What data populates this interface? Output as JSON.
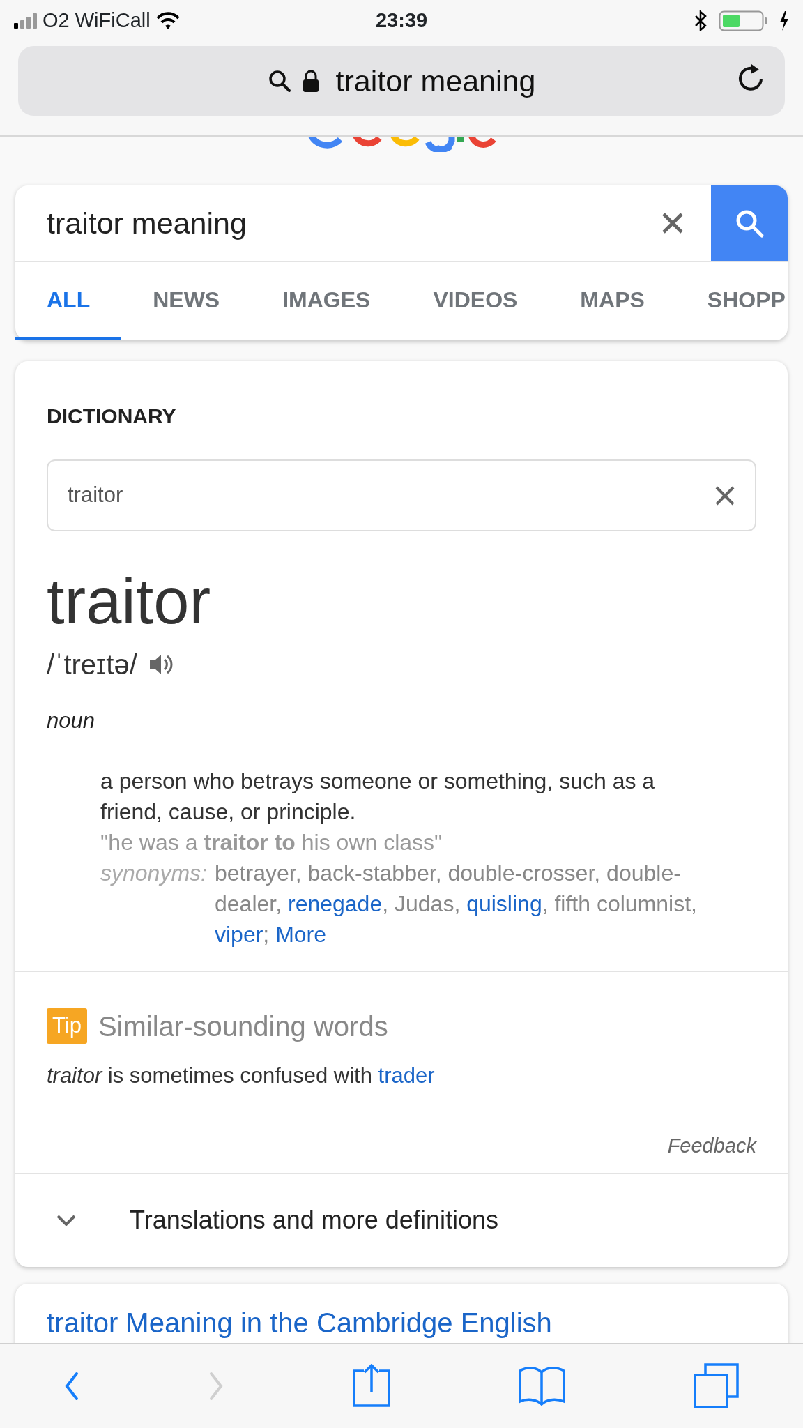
{
  "status_bar": {
    "carrier": "O2 WiFiCall",
    "time": "23:39"
  },
  "address_bar": {
    "text": "traitor meaning"
  },
  "search": {
    "value": "traitor meaning"
  },
  "tabs": [
    {
      "label": "ALL",
      "selected": true
    },
    {
      "label": "NEWS",
      "selected": false
    },
    {
      "label": "IMAGES",
      "selected": false
    },
    {
      "label": "VIDEOS",
      "selected": false
    },
    {
      "label": "MAPS",
      "selected": false
    },
    {
      "label": "SHOPP",
      "selected": false
    }
  ],
  "dictionary": {
    "heading": "DICTIONARY",
    "field_value": "traitor",
    "word": "traitor",
    "phonetic": "/ˈtreɪtə/",
    "part_of_speech": "noun",
    "definition": "a person who betrays someone or something, such as a friend, cause, or principle.",
    "example": "\"he was a **traitor to** his own class\"",
    "synonyms_label": "synonyms:",
    "synonyms": [
      {
        "text": "betrayer",
        "punct": ",",
        "link": false
      },
      {
        "text": "back-stabber",
        "punct": ",",
        "link": false
      },
      {
        "text": "double-crosser",
        "punct": ",",
        "link": false
      },
      {
        "text": "double-dealer",
        "punct": ",",
        "link": false
      },
      {
        "text": "renegade",
        "punct": ",",
        "link": true
      },
      {
        "text": "Judas",
        "punct": ",",
        "link": false
      },
      {
        "text": "quisling",
        "punct": ",",
        "link": true
      },
      {
        "text": "fifth columnist",
        "punct": ",",
        "link": false
      },
      {
        "text": "viper",
        "punct": ";",
        "link": true
      }
    ],
    "more": "More",
    "tip": {
      "badge": "Tip",
      "title": "Similar-sounding words",
      "sentence": "*traitor* is sometimes confused with",
      "link": "trader"
    },
    "feedback": "Feedback",
    "expander": {
      "label": "Translations and more definitions",
      "expanded": false
    }
  },
  "next_result": {
    "title": "traitor Meaning in the Cambridge English"
  },
  "toolbar": [
    {
      "kind": "back",
      "disabled": false
    },
    {
      "kind": "forward",
      "disabled": true
    },
    {
      "kind": "share",
      "disabled": false
    },
    {
      "kind": "bookmarks",
      "disabled": false
    },
    {
      "kind": "tabs",
      "disabled": false
    }
  ]
}
